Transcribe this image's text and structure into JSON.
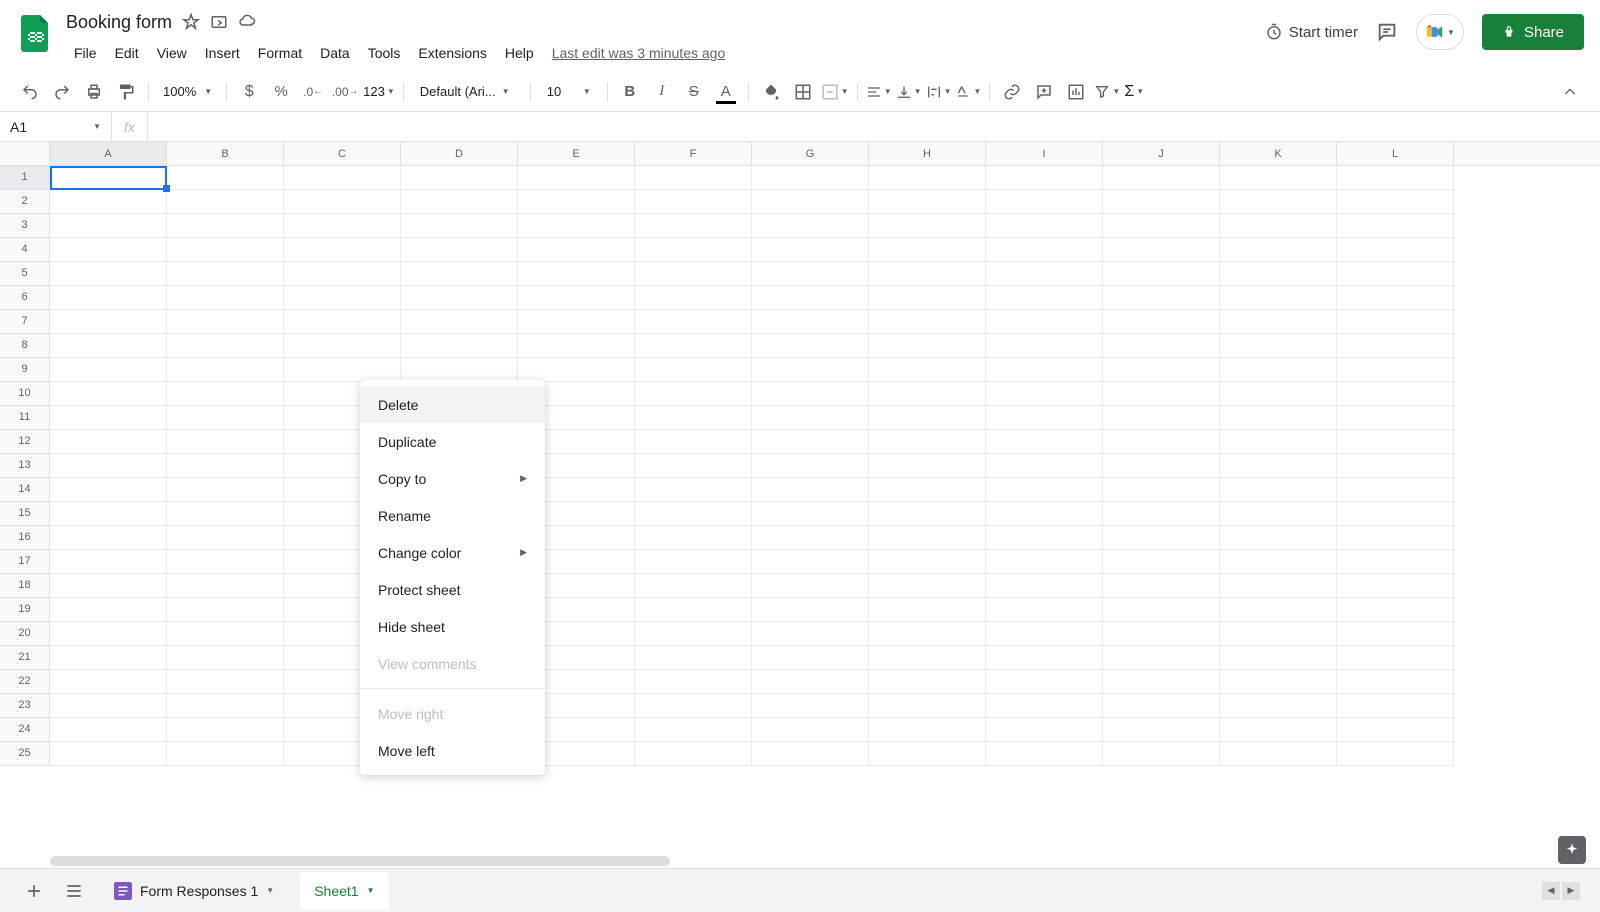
{
  "doc": {
    "title": "Booking form",
    "last_edit": "Last edit was 3 minutes ago"
  },
  "menu": {
    "file": "File",
    "edit": "Edit",
    "view": "View",
    "insert": "Insert",
    "format": "Format",
    "data": "Data",
    "tools": "Tools",
    "extensions": "Extensions",
    "help": "Help"
  },
  "header": {
    "start_timer": "Start timer",
    "share": "Share"
  },
  "toolbar": {
    "zoom": "100%",
    "font": "Default (Ari...",
    "size": "10",
    "more_formats": "123"
  },
  "formula": {
    "cell_ref": "A1",
    "fx": "fx"
  },
  "columns": [
    "A",
    "B",
    "C",
    "D",
    "E",
    "F",
    "G",
    "H",
    "I",
    "J",
    "K",
    "L"
  ],
  "rows": [
    "1",
    "2",
    "3",
    "4",
    "5",
    "6",
    "7",
    "8",
    "9",
    "10",
    "11",
    "12",
    "13",
    "14",
    "15",
    "16",
    "17",
    "18",
    "19",
    "20",
    "21",
    "22",
    "23",
    "24",
    "25"
  ],
  "tabs": {
    "form_responses": "Form Responses 1",
    "sheet1": "Sheet1"
  },
  "context_menu": {
    "delete": "Delete",
    "duplicate": "Duplicate",
    "copy_to": "Copy to",
    "rename": "Rename",
    "change_color": "Change color",
    "protect": "Protect sheet",
    "hide": "Hide sheet",
    "view_comments": "View comments",
    "move_right": "Move right",
    "move_left": "Move left"
  }
}
